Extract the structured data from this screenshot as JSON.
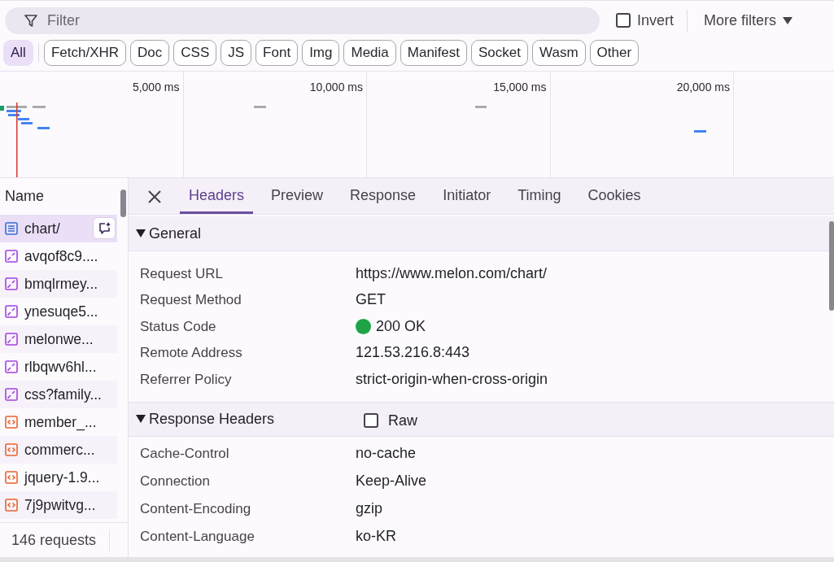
{
  "filter_bar": {
    "placeholder": "Filter",
    "invert": {
      "label": "Invert",
      "checked": false
    },
    "more_filters": "More filters"
  },
  "type_filters": [
    {
      "label": "All",
      "selected": true
    },
    {
      "label": "Fetch/XHR",
      "selected": false
    },
    {
      "label": "Doc",
      "selected": false
    },
    {
      "label": "CSS",
      "selected": false
    },
    {
      "label": "JS",
      "selected": false
    },
    {
      "label": "Font",
      "selected": false
    },
    {
      "label": "Img",
      "selected": false
    },
    {
      "label": "Media",
      "selected": false
    },
    {
      "label": "Manifest",
      "selected": false
    },
    {
      "label": "Socket",
      "selected": false
    },
    {
      "label": "Wasm",
      "selected": false
    },
    {
      "label": "Other",
      "selected": false
    }
  ],
  "timeline": {
    "ticks": [
      "5,000 ms",
      "10,000 ms",
      "15,000 ms",
      "20,000 ms"
    ]
  },
  "requests": {
    "column": "Name",
    "items": [
      {
        "name": "chart/",
        "kind": "document",
        "selected": true
      },
      {
        "name": "avqof8c9....",
        "kind": "fetch",
        "selected": false
      },
      {
        "name": "bmqlrmey...",
        "kind": "fetch",
        "selected": false
      },
      {
        "name": "ynesuqe5...",
        "kind": "fetch",
        "selected": false
      },
      {
        "name": "melonwe...",
        "kind": "fetch",
        "selected": false
      },
      {
        "name": "rlbqwv6hl...",
        "kind": "fetch",
        "selected": false
      },
      {
        "name": "css?family...",
        "kind": "fetch",
        "selected": false
      },
      {
        "name": "member_...",
        "kind": "script",
        "selected": false
      },
      {
        "name": "commerc...",
        "kind": "script",
        "selected": false
      },
      {
        "name": "jquery-1.9...",
        "kind": "script",
        "selected": false
      },
      {
        "name": "7j9pwitvg...",
        "kind": "script",
        "selected": false
      }
    ],
    "summary": "146 requests"
  },
  "details": {
    "tabs": [
      {
        "label": "Headers",
        "selected": true
      },
      {
        "label": "Preview",
        "selected": false
      },
      {
        "label": "Response",
        "selected": false
      },
      {
        "label": "Initiator",
        "selected": false
      },
      {
        "label": "Timing",
        "selected": false
      },
      {
        "label": "Cookies",
        "selected": false
      }
    ],
    "sections": [
      {
        "title": "General",
        "expanded": true,
        "rows": [
          {
            "name": "Request URL",
            "value": "https://www.melon.com/chart/"
          },
          {
            "name": "Request Method",
            "value": "GET"
          },
          {
            "name": "Status Code",
            "value": "200 OK",
            "kind": "status"
          },
          {
            "name": "Remote Address",
            "value": "121.53.216.8:443"
          },
          {
            "name": "Referrer Policy",
            "value": "strict-origin-when-cross-origin"
          }
        ]
      },
      {
        "title": "Response Headers",
        "expanded": true,
        "raw": {
          "label": "Raw",
          "checked": false
        },
        "rows": [
          {
            "name": "Cache-Control",
            "value": "no-cache"
          },
          {
            "name": "Connection",
            "value": "Keep-Alive"
          },
          {
            "name": "Content-Encoding",
            "value": "gzip"
          },
          {
            "name": "Content-Language",
            "value": "ko-KR"
          }
        ]
      }
    ]
  }
}
